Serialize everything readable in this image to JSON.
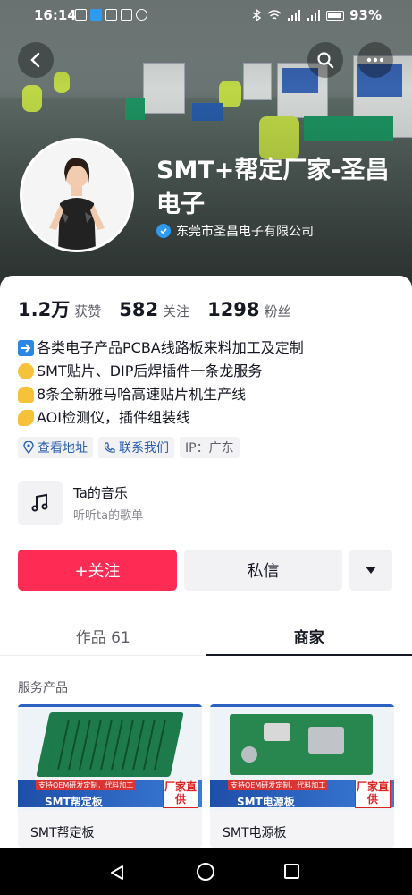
{
  "status_bar": {
    "time": "16:14",
    "battery": "93%"
  },
  "profile": {
    "name": "SMT+帮定厂家-圣昌电子",
    "verified_company": "东莞市圣昌电子有限公司",
    "stats": [
      {
        "value": "1.2万",
        "label": "获赞"
      },
      {
        "value": "582",
        "label": "关注"
      },
      {
        "value": "1298",
        "label": "粉丝"
      }
    ],
    "bio_lines": [
      {
        "emoji": "arrow-right-emoji",
        "text": "各类电子产品PCBA线路板来料加工及定制"
      },
      {
        "emoji": "handshake-emoji",
        "text": "SMT贴片、DIP后焊插件一条龙服务"
      },
      {
        "emoji": "thumbs-up-emoji",
        "text": "8条全新雅马哈高速贴片机生产线"
      },
      {
        "emoji": "flexed-biceps-emoji",
        "text": "AOI检测仪，插件组装线"
      }
    ],
    "chips": {
      "address": "查看地址",
      "contact": "联系我们",
      "ip": "IP：广东"
    }
  },
  "music": {
    "title": "Ta的音乐",
    "subtitle": "听听ta的歌单"
  },
  "actions": {
    "follow": "+关注",
    "message": "私信"
  },
  "tabs": [
    {
      "label": "作品 61",
      "active": false
    },
    {
      "label": "商家",
      "active": true
    }
  ],
  "services": {
    "section_title": "服务产品",
    "cards": [
      {
        "name": "SMT帮定板",
        "banner": "SMT帮定板",
        "badge": "厂家直供",
        "tagline": "支持OEM研发定制，代料加工"
      },
      {
        "name": "SMT电源板",
        "banner": "SMT电源板",
        "badge": "厂家直供",
        "tagline": "支持OEM研发定制，代料加工"
      }
    ]
  },
  "colors": {
    "accent": "#fe2c55",
    "verified": "#2d9bf0",
    "link": "#2a5fb0"
  }
}
